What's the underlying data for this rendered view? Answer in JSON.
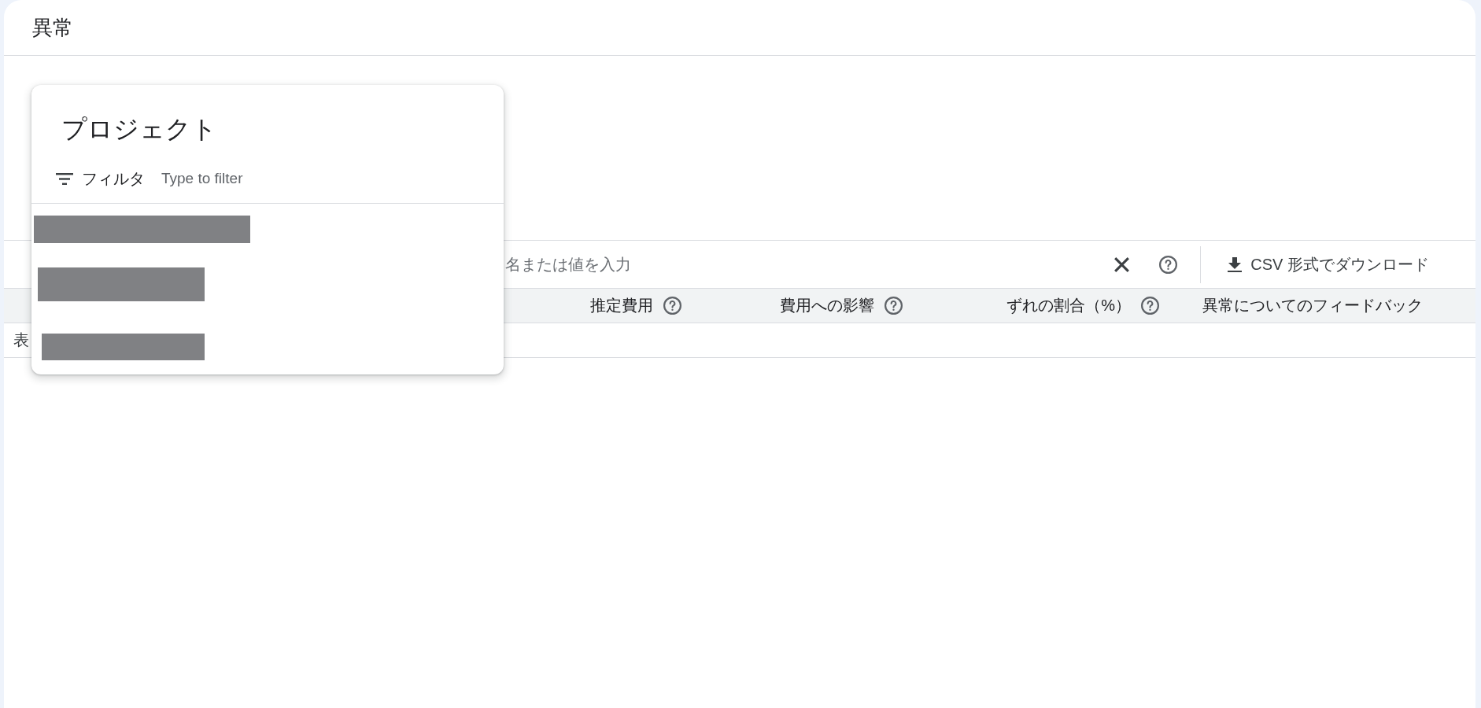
{
  "page": {
    "title": "異常"
  },
  "project_menu": {
    "title": "プロジェクト",
    "filter": {
      "label": "フィルタ",
      "placeholder": "Type to filter"
    }
  },
  "toolbar": {
    "search": {
      "placeholder": "名または値を入力"
    },
    "download_button": {
      "label": "CSV 形式でダウンロード"
    }
  },
  "table": {
    "columns": [
      {
        "label": "推定費用",
        "help": true
      },
      {
        "label": "費用への影響",
        "help": true
      },
      {
        "label": "ずれの割合（%）",
        "help": true
      },
      {
        "label": "異常についてのフィードバック",
        "help": false
      }
    ],
    "message": "表"
  }
}
